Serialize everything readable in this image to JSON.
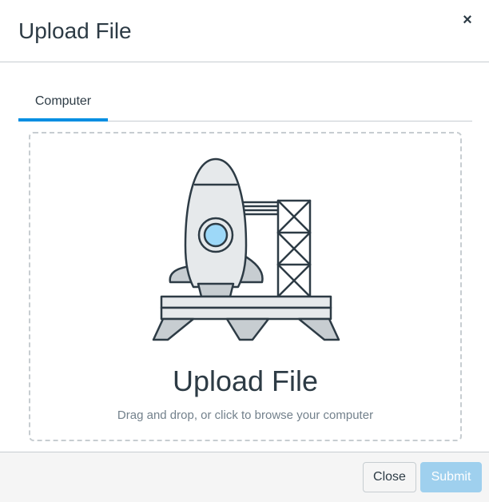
{
  "header": {
    "title": "Upload File",
    "close_glyph": "×",
    "close_icon": "close-icon"
  },
  "tabs": [
    {
      "label": "Computer",
      "selected": true
    }
  ],
  "dropzone": {
    "illustration": "rocket-launch-pad-illustration",
    "title": "Upload File",
    "hint": "Drag and drop, or click to browse your computer"
  },
  "footer": {
    "close_label": "Close",
    "submit_label": "Submit",
    "submit_disabled": true
  },
  "colors": {
    "accent": "#008ee2",
    "submit_disabled": "#9fd0ee",
    "text": "#2d3b45",
    "muted_text": "#73818c",
    "border": "#c7cdd1",
    "porthole": "#9dd8f8"
  }
}
